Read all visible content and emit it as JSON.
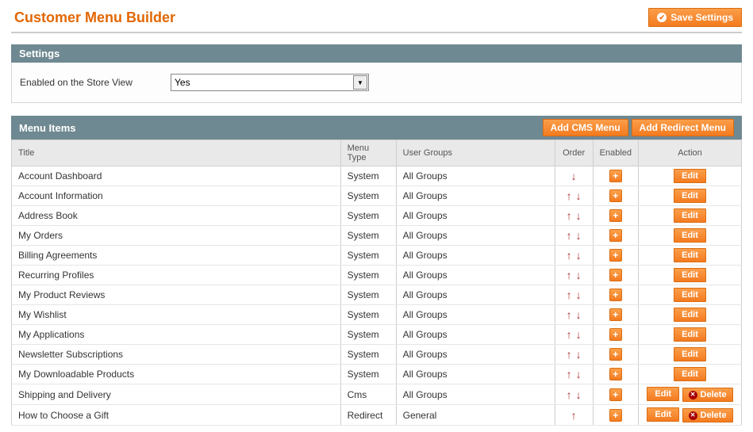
{
  "header": {
    "title": "Customer Menu Builder",
    "save_label": "Save Settings"
  },
  "settings": {
    "panel_title": "Settings",
    "field_label": "Enabled on the Store View",
    "value": "Yes"
  },
  "menu_items": {
    "panel_title": "Menu Items",
    "add_cms_label": "Add CMS Menu",
    "add_redirect_label": "Add Redirect Menu",
    "columns": {
      "title": "Title",
      "menu_type": "Menu Type",
      "user_groups": "User Groups",
      "order": "Order",
      "enabled": "Enabled",
      "action": "Action"
    },
    "edit_label": "Edit",
    "delete_label": "Delete",
    "rows": [
      {
        "title": "Account Dashboard",
        "type": "System",
        "groups": "All Groups",
        "up": false,
        "down": true,
        "deletable": false
      },
      {
        "title": "Account Information",
        "type": "System",
        "groups": "All Groups",
        "up": true,
        "down": true,
        "deletable": false
      },
      {
        "title": "Address Book",
        "type": "System",
        "groups": "All Groups",
        "up": true,
        "down": true,
        "deletable": false
      },
      {
        "title": "My Orders",
        "type": "System",
        "groups": "All Groups",
        "up": true,
        "down": true,
        "deletable": false
      },
      {
        "title": "Billing Agreements",
        "type": "System",
        "groups": "All Groups",
        "up": true,
        "down": true,
        "deletable": false
      },
      {
        "title": "Recurring Profiles",
        "type": "System",
        "groups": "All Groups",
        "up": true,
        "down": true,
        "deletable": false
      },
      {
        "title": "My Product Reviews",
        "type": "System",
        "groups": "All Groups",
        "up": true,
        "down": true,
        "deletable": false
      },
      {
        "title": "My Wishlist",
        "type": "System",
        "groups": "All Groups",
        "up": true,
        "down": true,
        "deletable": false
      },
      {
        "title": "My Applications",
        "type": "System",
        "groups": "All Groups",
        "up": true,
        "down": true,
        "deletable": false
      },
      {
        "title": "Newsletter Subscriptions",
        "type": "System",
        "groups": "All Groups",
        "up": true,
        "down": true,
        "deletable": false
      },
      {
        "title": "My Downloadable Products",
        "type": "System",
        "groups": "All Groups",
        "up": true,
        "down": true,
        "deletable": false
      },
      {
        "title": "Shipping and Delivery",
        "type": "Cms",
        "groups": "All Groups",
        "up": true,
        "down": true,
        "deletable": true
      },
      {
        "title": "How to Choose a Gift",
        "type": "Redirect",
        "groups": "General",
        "up": true,
        "down": false,
        "deletable": true
      }
    ]
  }
}
